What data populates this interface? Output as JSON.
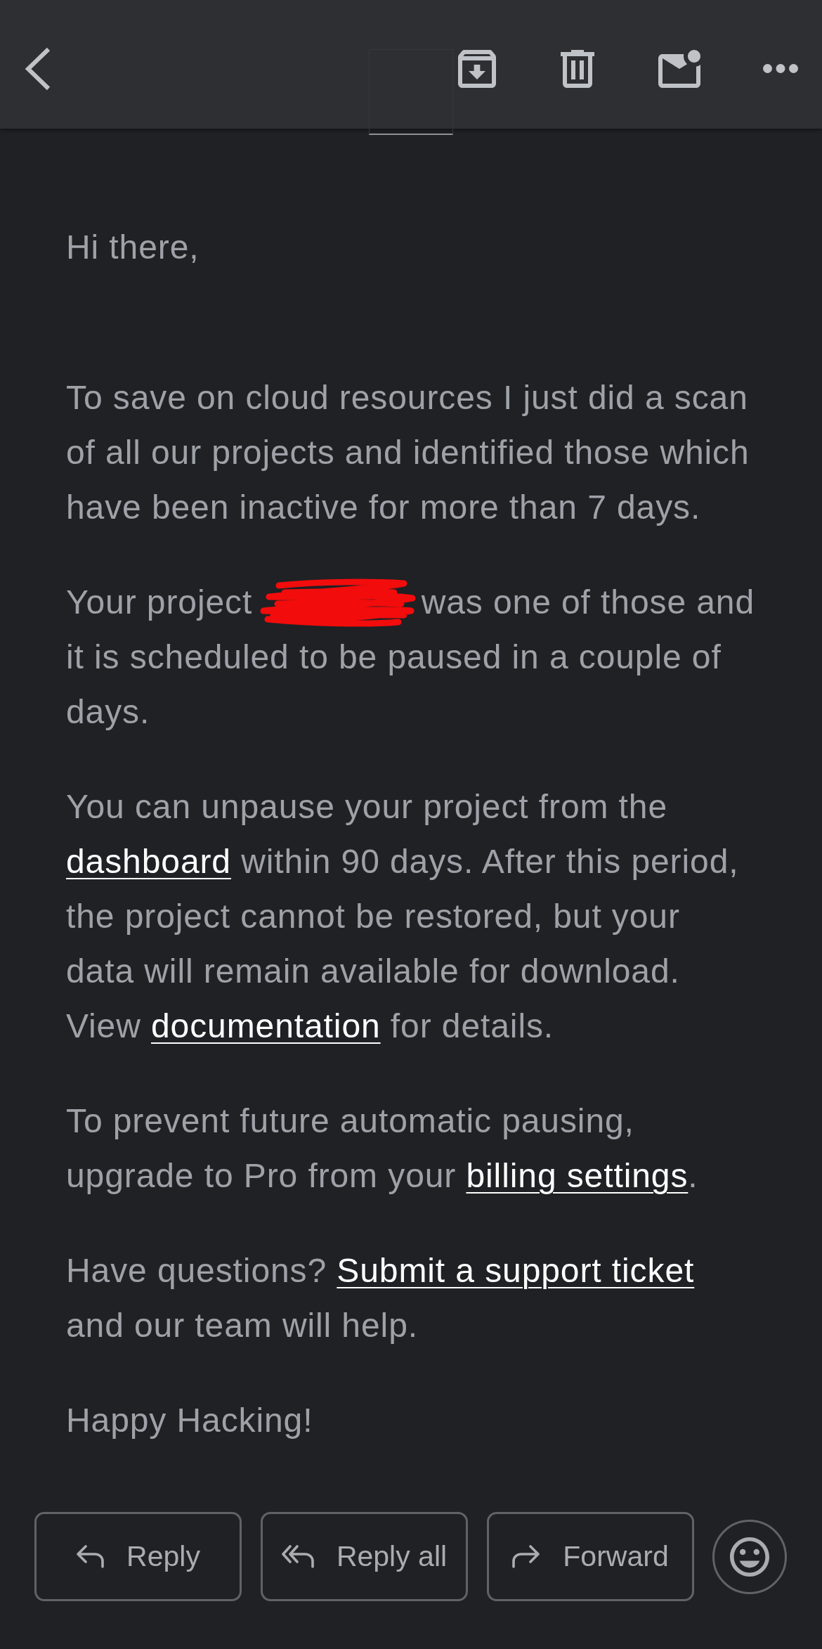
{
  "greeting": "Hi there,",
  "paragraphs": [
    {
      "parts": [
        {
          "kind": "text",
          "text": "To save on cloud resources I just did a scan of all our projects and identified those which have been inactive for more than 7 days."
        }
      ]
    },
    {
      "parts": [
        {
          "kind": "text",
          "text": "Your project "
        },
        {
          "kind": "redaction"
        },
        {
          "kind": "text",
          "text": " was one of those and it is scheduled to be paused in a couple of days."
        }
      ]
    },
    {
      "parts": [
        {
          "kind": "text",
          "text": "You can unpause your project from the "
        },
        {
          "kind": "link",
          "text": "dashboard"
        },
        {
          "kind": "text",
          "text": " within 90 days. After this period, the project cannot be restored, but your data will remain available for download. View "
        },
        {
          "kind": "link",
          "text": "documentation"
        },
        {
          "kind": "text",
          "text": " for details."
        }
      ]
    },
    {
      "parts": [
        {
          "kind": "text",
          "text": "To prevent future automatic pausing, upgrade to Pro from your "
        },
        {
          "kind": "link",
          "text": "billing settings"
        },
        {
          "kind": "text",
          "text": "."
        }
      ]
    },
    {
      "parts": [
        {
          "kind": "text",
          "text": "Have questions? "
        },
        {
          "kind": "link",
          "text": "Submit a support ticket"
        },
        {
          "kind": "text",
          "text": " and our team will help."
        }
      ]
    }
  ],
  "sign_off": "Happy Hacking!",
  "actions": [
    {
      "kind": "reply",
      "label": "Reply"
    },
    {
      "kind": "reply_all",
      "label": "Reply all"
    },
    {
      "kind": "forward",
      "label": "Forward"
    }
  ]
}
